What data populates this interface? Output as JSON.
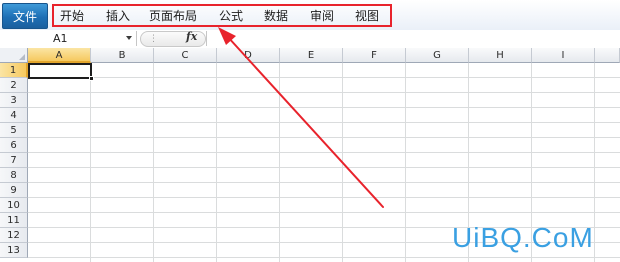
{
  "ribbon": {
    "file_tab": "文件",
    "tabs": [
      {
        "label": "开始"
      },
      {
        "label": "插入"
      },
      {
        "label": "页面布局"
      },
      {
        "label": "公式"
      },
      {
        "label": "数据"
      },
      {
        "label": "审阅"
      },
      {
        "label": "视图"
      }
    ],
    "highlight_color": "#e8232c"
  },
  "formula_bar": {
    "name_box": "A1",
    "fx_label": "fx",
    "formula": ""
  },
  "sheet": {
    "columns": [
      "A",
      "B",
      "C",
      "D",
      "E",
      "F",
      "G",
      "H",
      "I"
    ],
    "rows": [
      "1",
      "2",
      "3",
      "4",
      "5",
      "6",
      "7",
      "8",
      "9",
      "10",
      "11",
      "12",
      "13"
    ],
    "active_cell": "A1"
  },
  "watermark": "UiBQ.CoM",
  "colors": {
    "file_tab": "#1e6fb5",
    "selection_header": "#f6c95f",
    "arrow": "#e8232c",
    "watermark": "#3aa0e2"
  }
}
